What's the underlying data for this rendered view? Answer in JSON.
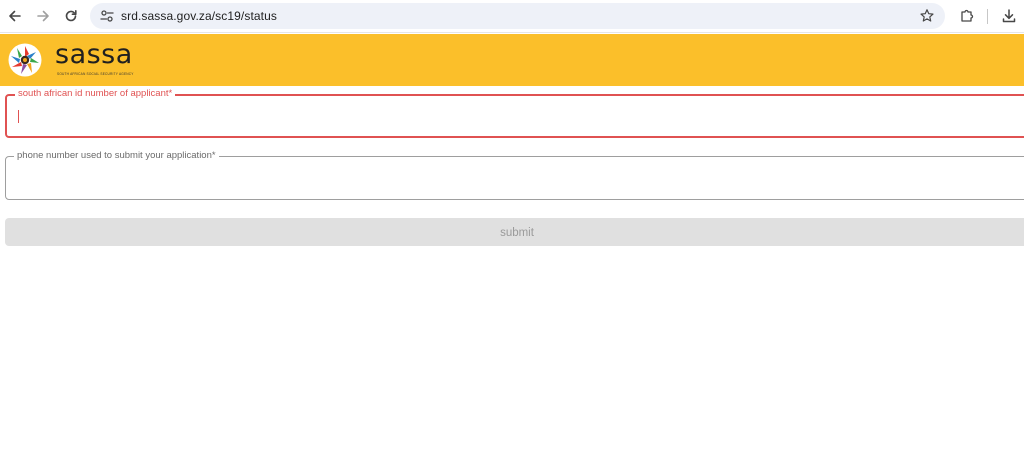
{
  "browser": {
    "url": "srd.sassa.gov.za/sc19/status",
    "icons": {
      "back": "back-arrow-icon",
      "forward": "forward-arrow-icon",
      "reload": "reload-icon",
      "site_info": "tune-icon",
      "bookmark": "star-icon",
      "extensions": "puzzle-icon",
      "download": "download-icon"
    }
  },
  "header": {
    "logo_text": "sassa",
    "logo_subtitle": "SOUTH AFRICAN SOCIAL SECURITY AGENCY",
    "background_color": "#fbbf2a"
  },
  "form": {
    "id_field": {
      "label": "south african id number of applicant*",
      "value": "",
      "state": "invalid-focused",
      "accent_color": "#e05252"
    },
    "phone_field": {
      "label": "phone number used to submit your application*",
      "value": ""
    },
    "submit_label": "submit",
    "submit_state": "disabled"
  }
}
